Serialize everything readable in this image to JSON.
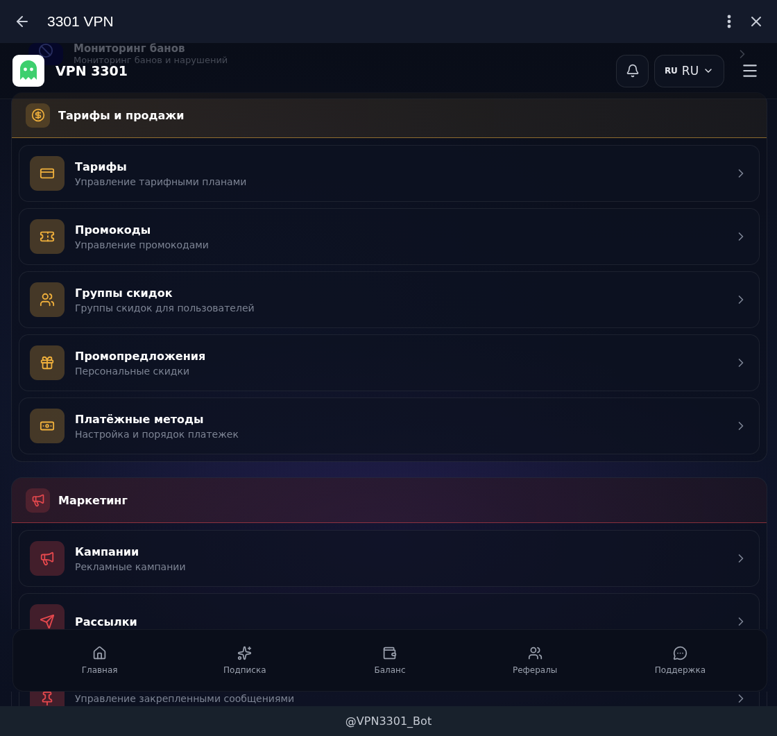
{
  "window": {
    "title": "3301 VPN"
  },
  "header": {
    "app_name": "VPN 3301",
    "language": {
      "code": "RU",
      "label": "RU"
    }
  },
  "scrolled_row": {
    "title": "Мониторинг банов",
    "subtitle": "Мониторинг банов и нарушений"
  },
  "sections": [
    {
      "title": "Тарифы и продажи",
      "color": "#f0b03c",
      "items": [
        {
          "title": "Тарифы",
          "subtitle": "Управление тарифными планами"
        },
        {
          "title": "Промокоды",
          "subtitle": "Управление промокодами"
        },
        {
          "title": "Группы скидок",
          "subtitle": "Группы скидок для пользователей"
        },
        {
          "title": "Промопредложения",
          "subtitle": "Персональные скидки"
        },
        {
          "title": "Платёжные методы",
          "subtitle": "Настройка и порядок платежек"
        }
      ]
    },
    {
      "title": "Маркетинг",
      "color": "#e5484d",
      "items": [
        {
          "title": "Кампании",
          "subtitle": "Рекламные кампании"
        },
        {
          "title": "Рассылки"
        },
        {
          "subtitle": "Управление закрепленными сообщениями"
        }
      ]
    }
  ],
  "bottom_nav": [
    {
      "label": "Главная"
    },
    {
      "label": "Подписка"
    },
    {
      "label": "Баланс"
    },
    {
      "label": "Рефералы"
    },
    {
      "label": "Поддержка"
    }
  ],
  "footer": {
    "text": "@VPN3301_Bot"
  }
}
